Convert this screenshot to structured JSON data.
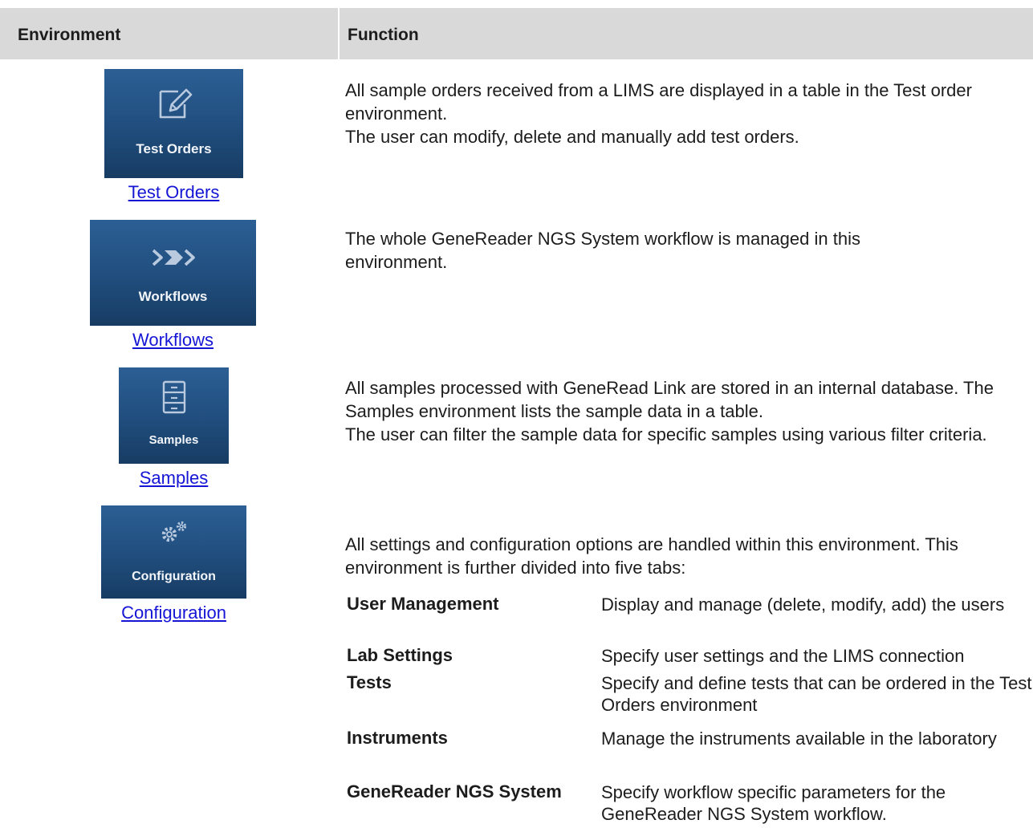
{
  "table": {
    "header": {
      "environment": "Environment",
      "function": "Function"
    },
    "rows": [
      {
        "tile_label": "Test Orders",
        "icon": "edit-order-icon",
        "link": "Test Orders",
        "paragraphs": [
          "All sample orders received from a LIMS are displayed in a table in the Test order environment.",
          "The user can modify, delete and manually add test orders."
        ]
      },
      {
        "tile_label": "Workflows",
        "icon": "chevrons-icon",
        "link": "Workflows",
        "paragraphs": [
          "The whole GeneReader NGS System workflow is managed in this environment."
        ]
      },
      {
        "tile_label": "Samples",
        "icon": "cabinet-icon",
        "link": "Samples",
        "paragraphs": [
          "All samples processed with GeneRead Link are stored in an internal database. The Samples environment lists the sample data in a table.",
          "The user can filter the sample data for specific samples using various filter criteria."
        ]
      },
      {
        "tile_label": "Configuration",
        "icon": "gears-icon",
        "link": "Configuration",
        "paragraphs": [
          "All settings and configuration options are handled within this environment. This environment is further divided into five tabs:"
        ],
        "tabs": [
          {
            "name": "User Management",
            "description": "Display and manage (delete, modify, add) the users"
          },
          {
            "name": "Lab Settings",
            "description": "Specify user settings and the LIMS connection"
          },
          {
            "name": "Tests",
            "description": "Specify and define tests that can be ordered in the Test Orders environment"
          },
          {
            "name": "Instruments",
            "description": "Manage the instruments available in the laboratory"
          },
          {
            "name": "GeneReader NGS System",
            "description": "Specify workflow specific parameters for the GeneReader NGS System workflow."
          }
        ]
      }
    ]
  }
}
